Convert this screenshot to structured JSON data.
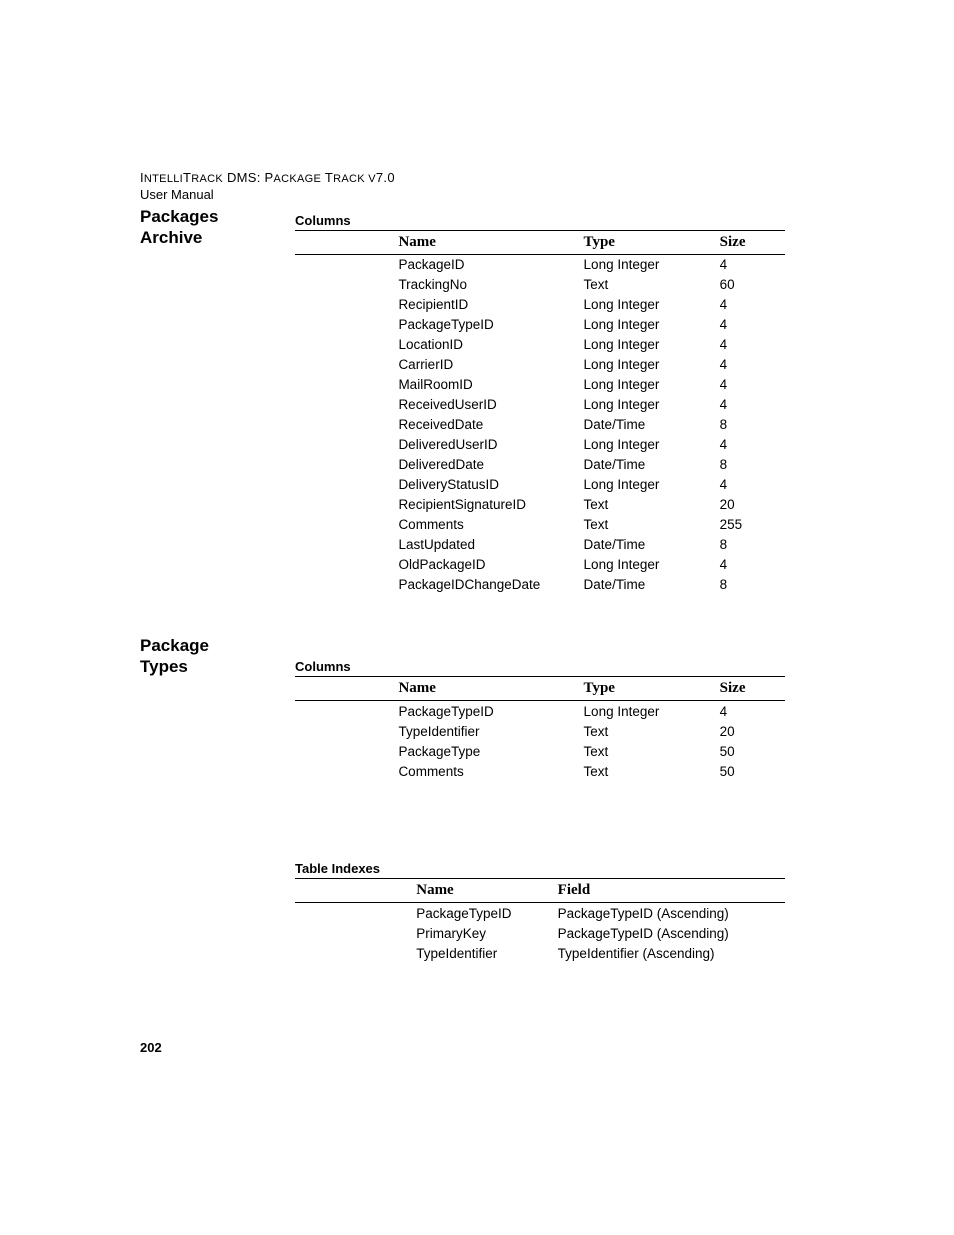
{
  "header": {
    "line1_part1": "I",
    "line1_part2": "NTELLI",
    "line1_part3": "T",
    "line1_part4": "RACK",
    "line1_part5": " DMS: P",
    "line1_part6": "ACKAGE",
    "line1_part7": " T",
    "line1_part8": "RACK V",
    "line1_part9": "7.0",
    "line2": "User Manual"
  },
  "sections": {
    "packages_archive": {
      "heading_line1": "Packages",
      "heading_line2": "Archive",
      "columns_label": "Columns",
      "table_headers": {
        "name": "Name",
        "type": "Type",
        "size": "Size"
      },
      "rows": [
        {
          "name": "PackageID",
          "type": "Long Integer",
          "size": "4"
        },
        {
          "name": "TrackingNo",
          "type": "Text",
          "size": "60"
        },
        {
          "name": "RecipientID",
          "type": "Long Integer",
          "size": "4"
        },
        {
          "name": "PackageTypeID",
          "type": "Long Integer",
          "size": "4"
        },
        {
          "name": "LocationID",
          "type": "Long Integer",
          "size": "4"
        },
        {
          "name": "CarrierID",
          "type": "Long Integer",
          "size": "4"
        },
        {
          "name": "MailRoomID",
          "type": "Long Integer",
          "size": "4"
        },
        {
          "name": "ReceivedUserID",
          "type": "Long Integer",
          "size": "4"
        },
        {
          "name": "ReceivedDate",
          "type": "Date/Time",
          "size": "8"
        },
        {
          "name": "DeliveredUserID",
          "type": "Long Integer",
          "size": "4"
        },
        {
          "name": "DeliveredDate",
          "type": "Date/Time",
          "size": "8"
        },
        {
          "name": "DeliveryStatusID",
          "type": "Long Integer",
          "size": "4"
        },
        {
          "name": "RecipientSignatureID",
          "type": "Text",
          "size": "20"
        },
        {
          "name": "Comments",
          "type": "Text",
          "size": "255"
        },
        {
          "name": "LastUpdated",
          "type": "Date/Time",
          "size": "8"
        },
        {
          "name": "OldPackageID",
          "type": "Long Integer",
          "size": "4"
        },
        {
          "name": "PackageIDChangeDate",
          "type": "Date/Time",
          "size": "8"
        }
      ]
    },
    "package_types": {
      "heading_line1": "Package",
      "heading_line2": "Types",
      "columns_label": "Columns",
      "table_headers": {
        "name": "Name",
        "type": "Type",
        "size": "Size"
      },
      "rows": [
        {
          "name": "PackageTypeID",
          "type": "Long Integer",
          "size": "4"
        },
        {
          "name": "TypeIdentifier",
          "type": "Text",
          "size": "20"
        },
        {
          "name": "PackageType",
          "type": "Text",
          "size": "50"
        },
        {
          "name": "Comments",
          "type": "Text",
          "size": "50"
        }
      ],
      "indexes_label": "Table Indexes",
      "indexes_headers": {
        "name": "Name",
        "field": "Field"
      },
      "indexes_rows": [
        {
          "name": "PackageTypeID",
          "field": "PackageTypeID (Ascending)"
        },
        {
          "name": "PrimaryKey",
          "field": "PackageTypeID (Ascending)"
        },
        {
          "name": "TypeIdentifier",
          "field": "TypeIdentifier (Ascending)"
        }
      ]
    }
  },
  "page_number": "202"
}
